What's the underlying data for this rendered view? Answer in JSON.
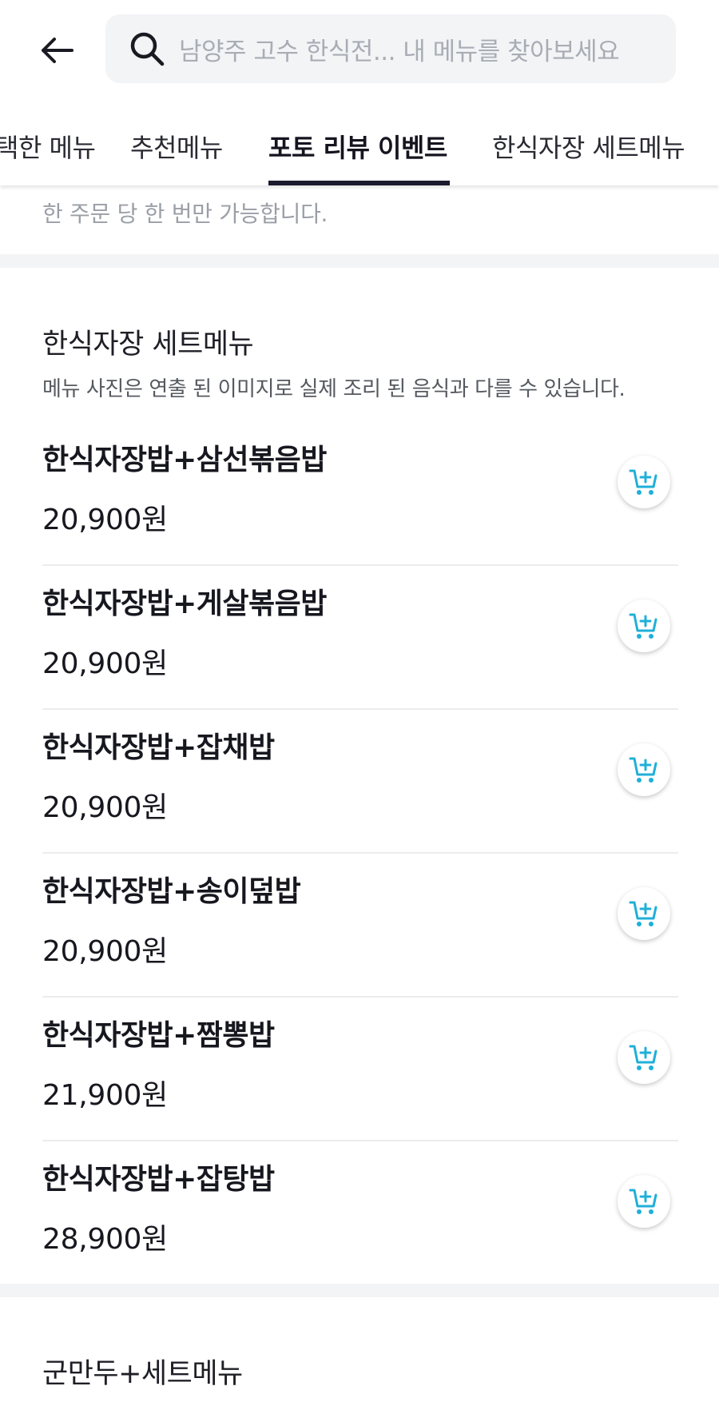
{
  "search": {
    "placeholder": "남양주 고수 한식전... 내 메뉴를 찾아보세요"
  },
  "tabs": [
    {
      "label": "택한 메뉴",
      "active": false
    },
    {
      "label": "추천메뉴",
      "active": false
    },
    {
      "label": "포토 리뷰 이벤트",
      "active": true
    },
    {
      "label": "한식자장 세트메뉴",
      "active": false
    }
  ],
  "notice": {
    "text": "한 주문 당 한 번만 가능합니다."
  },
  "set_section": {
    "title": "한식자장 세트메뉴",
    "description": "메뉴 사진은 연출 된 이미지로 실제 조리 된 음식과 다를 수 있습니다.",
    "items": [
      {
        "name": "한식자장밥+삼선볶음밥",
        "price": "20,900원"
      },
      {
        "name": "한식자장밥+게살볶음밥",
        "price": "20,900원"
      },
      {
        "name": "한식자장밥+잡채밥",
        "price": "20,900원"
      },
      {
        "name": "한식자장밥+송이덮밥",
        "price": "20,900원"
      },
      {
        "name": "한식자장밥+짬뽕밥",
        "price": "21,900원"
      },
      {
        "name": "한식자장밥+잡탕밥",
        "price": "28,900원"
      }
    ]
  },
  "next_section": {
    "title": "군만두+세트메뉴"
  },
  "icons": {
    "back": "arrow-left-icon",
    "search": "search-icon",
    "cart": "cart-add-icon"
  },
  "colors": {
    "accent": "#1fb0d8",
    "tab_underline": "#1b1a2e",
    "section_gap": "#f3f4f6"
  }
}
